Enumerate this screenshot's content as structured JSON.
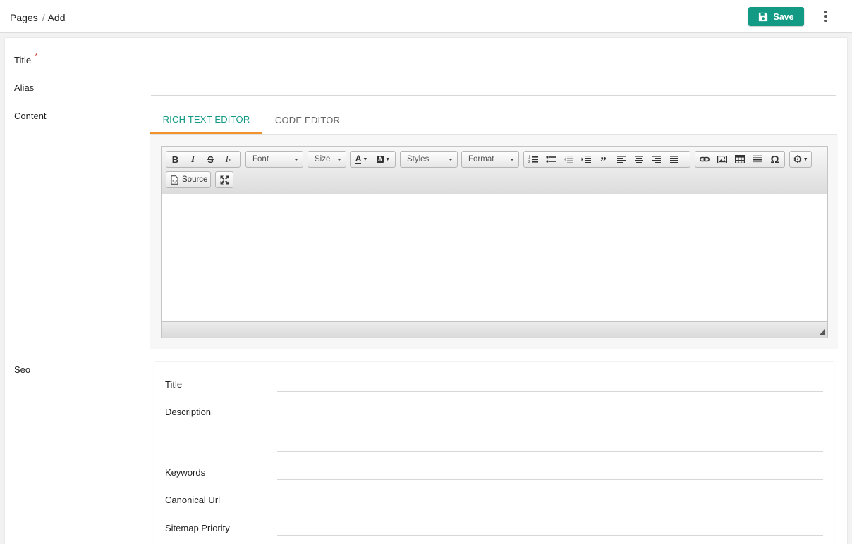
{
  "breadcrumb": {
    "section": "Pages",
    "current": "Add"
  },
  "toolbar": {
    "save_label": "Save"
  },
  "colors": {
    "accent": "#129a85",
    "tab_underline": "#f0932b",
    "required": "#d9534f"
  },
  "form": {
    "title_label": "Title",
    "title_required_mark": "*",
    "alias_label": "Alias",
    "content_label": "Content",
    "seo_label": "Seo"
  },
  "tabs": [
    {
      "label": "RICH TEXT EDITOR",
      "active": true
    },
    {
      "label": "CODE EDITOR",
      "active": false
    }
  ],
  "editor": {
    "font_combo": "Font",
    "size_combo": "Size",
    "styles_combo": "Styles",
    "format_combo": "Format",
    "source_label": "Source"
  },
  "seo": {
    "title_label": "Title",
    "description_label": "Description",
    "keywords_label": "Keywords",
    "canonical_label": "Canonical Url",
    "sitemap_label": "Sitemap Priority"
  }
}
